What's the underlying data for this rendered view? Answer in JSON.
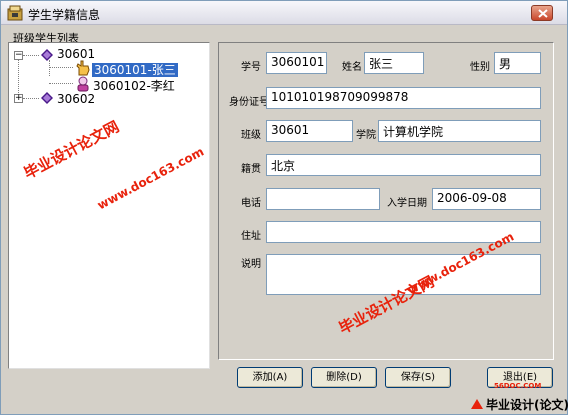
{
  "window": {
    "title": "学生学籍信息",
    "close_glyph": "×"
  },
  "tree": {
    "label": "班级学生列表",
    "nodes": [
      {
        "label": "30601",
        "expander": "−",
        "icon": "diamond-icon"
      },
      {
        "label": "3060101-张三",
        "icon": "hand-pointer-icon",
        "selected": true
      },
      {
        "label": "3060102-李红",
        "icon": "student-icon"
      },
      {
        "label": "30602",
        "expander": "+",
        "icon": "diamond-icon"
      }
    ]
  },
  "form": {
    "student_id": {
      "label": "学号",
      "value": "3060101"
    },
    "name": {
      "label": "姓名",
      "value": "张三"
    },
    "gender": {
      "label": "性别",
      "value": "男"
    },
    "id_card": {
      "label": "身份证号",
      "value": "101010198709099878"
    },
    "class": {
      "label": "班级",
      "value": "30601"
    },
    "college": {
      "label": "学院",
      "value": "计算机学院"
    },
    "native_place": {
      "label": "籍贯",
      "value": "北京"
    },
    "phone": {
      "label": "电话",
      "value": ""
    },
    "enroll_date": {
      "label": "入学日期",
      "value": "2006-09-08"
    },
    "address": {
      "label": "住址",
      "value": ""
    },
    "notes": {
      "label": "说明",
      "value": ""
    }
  },
  "buttons": {
    "add": "添加(A)",
    "delete": "删除(D)",
    "save": "保存(S)",
    "exit": "退出(E)"
  },
  "watermark": {
    "cn": "毕业设计论文网",
    "url": "www.doc163.com",
    "logo_small": "56DOC.COM",
    "logo_text": "毕业设计(论文)网"
  },
  "colors": {
    "accent_selection": "#316ac5",
    "watermark": "#e8220c",
    "close_button": "#c9462a"
  }
}
